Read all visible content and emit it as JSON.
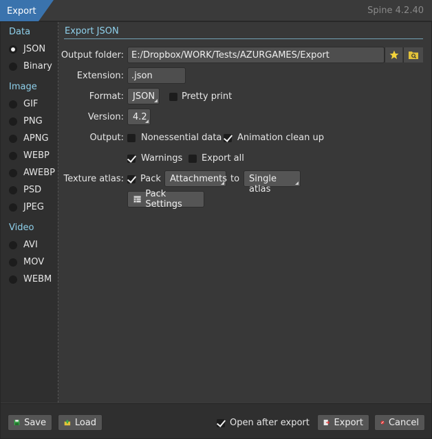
{
  "titlebar": {
    "tab": "Export",
    "version": "Spine 4.2.40"
  },
  "sidebar": {
    "data_label": "Data",
    "data_items": [
      {
        "label": "JSON",
        "selected": true
      },
      {
        "label": "Binary",
        "selected": false
      }
    ],
    "image_label": "Image",
    "image_items": [
      {
        "label": "GIF"
      },
      {
        "label": "PNG"
      },
      {
        "label": "APNG"
      },
      {
        "label": "WEBP"
      },
      {
        "label": "AWEBP"
      },
      {
        "label": "PSD"
      },
      {
        "label": "JPEG"
      }
    ],
    "video_label": "Video",
    "video_items": [
      {
        "label": "AVI"
      },
      {
        "label": "MOV"
      },
      {
        "label": "WEBM"
      }
    ]
  },
  "main": {
    "title": "Export JSON",
    "output_folder": {
      "label": "Output folder:",
      "value": "E:/Dropbox/WORK/Tests/AZURGAMES/Export"
    },
    "extension": {
      "label": "Extension:",
      "value": ".json"
    },
    "format": {
      "label": "Format:",
      "value": "JSON",
      "pretty_print": "Pretty print",
      "pretty_checked": false
    },
    "version": {
      "label": "Version:",
      "value": "4.2"
    },
    "output": {
      "label": "Output:",
      "nonessential": "Nonessential data",
      "nonessential_checked": false,
      "cleanup": "Animation clean up",
      "cleanup_checked": true,
      "warnings": "Warnings",
      "warnings_checked": true,
      "export_all": "Export all",
      "export_all_checked": false
    },
    "texture_atlas": {
      "label": "Texture atlas:",
      "pack": "Pack",
      "pack_checked": true,
      "source": "Attachments",
      "to": "to",
      "target": "Single atlas",
      "settings_button": "Pack Settings"
    }
  },
  "footer": {
    "save": "Save",
    "load": "Load",
    "open_after": "Open after export",
    "open_after_checked": true,
    "export": "Export",
    "cancel": "Cancel"
  },
  "colors": {
    "accent": "#8fd1ec",
    "title_tab": "#3a73ad",
    "background": "#383838"
  }
}
